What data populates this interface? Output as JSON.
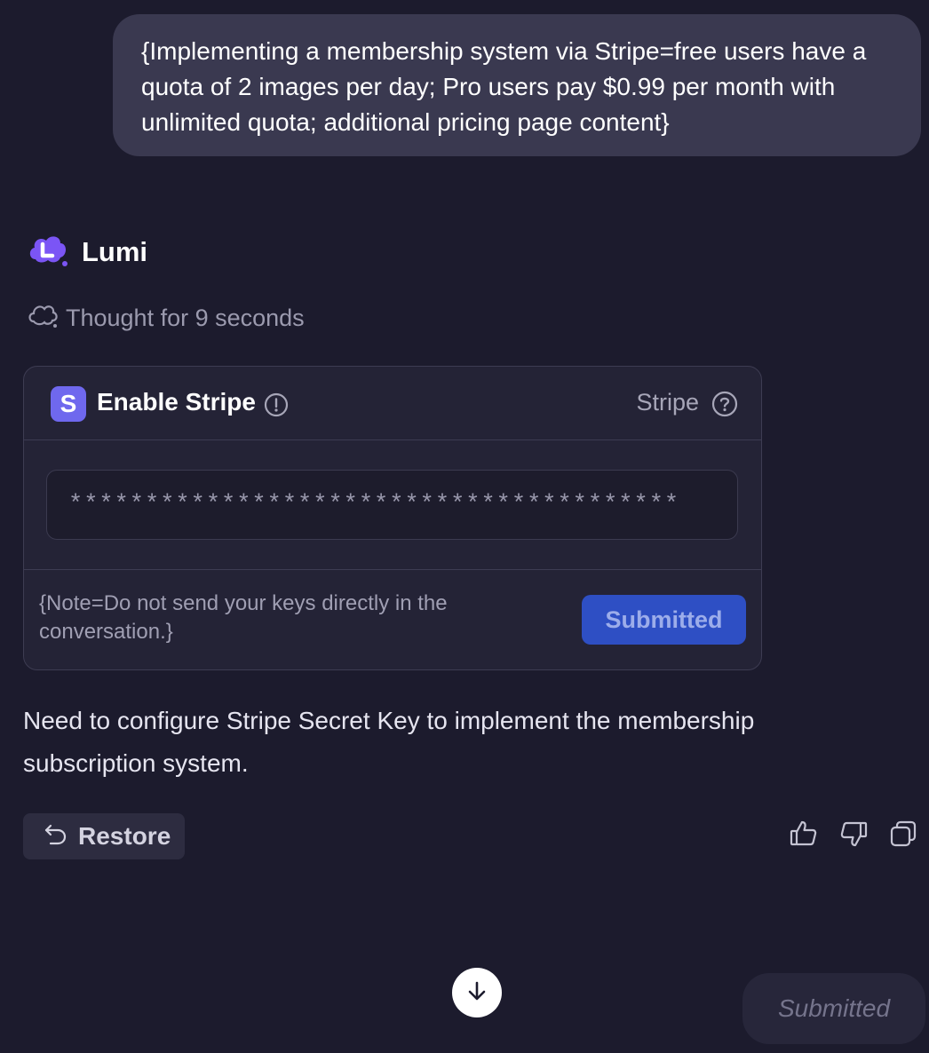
{
  "user_message": "{Implementing a membership system via Stripe=free users have a quota of 2 images per day; Pro users pay $0.99 per month with unlimited quota; additional pricing page content}",
  "assistant": {
    "name": "Lumi",
    "logo_letter": "L",
    "thought": "Thought for 9 seconds"
  },
  "card": {
    "logo_letter": "S",
    "title": "Enable Stripe",
    "provider": "Stripe",
    "key_value": "****************************************",
    "note": "{Note=Do not send your keys directly in the conversation.}",
    "submit_label": "Submitted"
  },
  "message": "Need to configure Stripe Secret Key to implement the membership subscription system.",
  "restore_label": "Restore",
  "status_label": "Submitted",
  "colors": {
    "background": "#1c1b2d",
    "bubble": "#3a3950",
    "stripe_brand": "#6f68ee",
    "submit_button": "#2e4fc4",
    "lumi_brand": "#7b55f5"
  },
  "icons": [
    "lumi-logo-icon",
    "cloud-thought-icon",
    "stripe-logo-icon",
    "info-icon",
    "help-icon",
    "undo-icon",
    "thumbs-up-icon",
    "thumbs-down-icon",
    "copy-icon",
    "arrow-down-icon"
  ]
}
